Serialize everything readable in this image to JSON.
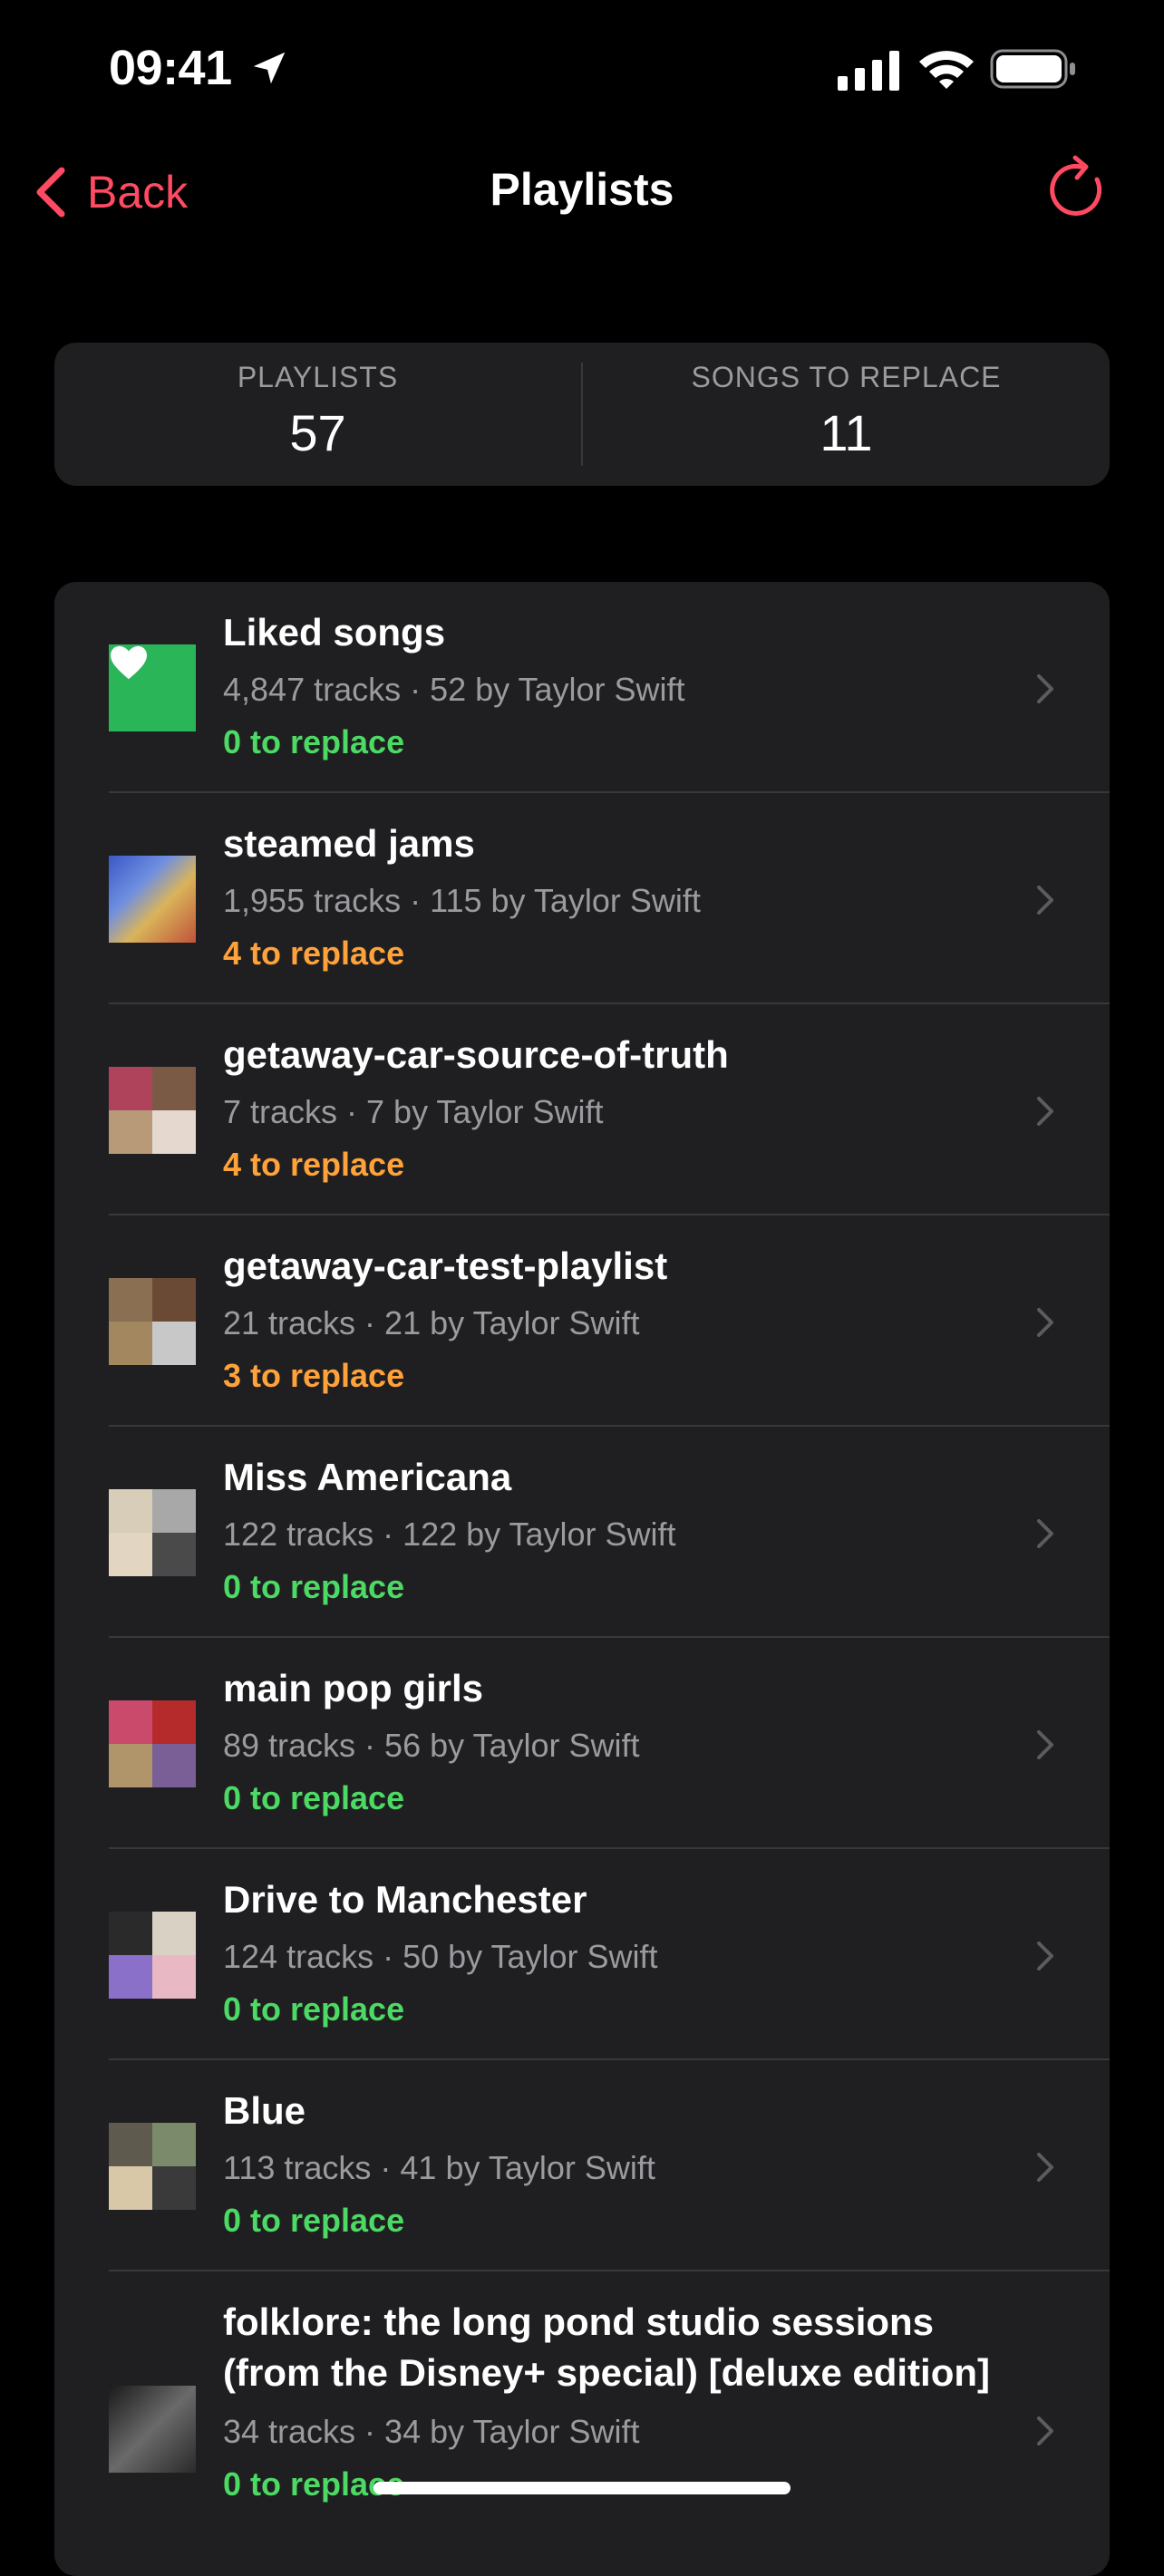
{
  "status_bar": {
    "time": "09:41"
  },
  "nav": {
    "back_label": "Back",
    "title": "Playlists"
  },
  "stats": {
    "playlists_label": "PLAYLISTS",
    "playlists_value": "57",
    "songs_label": "SONGS TO REPLACE",
    "songs_value": "11"
  },
  "colors": {
    "accent": "#ff4a62",
    "ok": "#4cd964",
    "warn": "#ffa23a"
  },
  "playlists": [
    {
      "title": "Liked songs",
      "meta": "4,847 tracks · 52 by Taylor Swift",
      "replace": "0 to replace",
      "status": "ok",
      "artwork": "heart-icon"
    },
    {
      "title": "steamed jams",
      "meta": "1,955 tracks · 115 by Taylor Swift",
      "replace": "4 to replace",
      "status": "warn",
      "artwork": "cartoon-cover"
    },
    {
      "title": "getaway-car-source-of-truth",
      "meta": "7 tracks · 7 by Taylor Swift",
      "replace": "4 to replace",
      "status": "warn",
      "artwork": "album-mosaic"
    },
    {
      "title": "getaway-car-test-playlist",
      "meta": "21 tracks · 21 by Taylor Swift",
      "replace": "3 to replace",
      "status": "warn",
      "artwork": "album-mosaic"
    },
    {
      "title": "Miss Americana",
      "meta": "122 tracks · 122 by Taylor Swift",
      "replace": "0 to replace",
      "status": "ok",
      "artwork": "album-mosaic"
    },
    {
      "title": "main pop girls",
      "meta": "89 tracks · 56 by Taylor Swift",
      "replace": "0 to replace",
      "status": "ok",
      "artwork": "album-mosaic"
    },
    {
      "title": "Drive to Manchester",
      "meta": "124 tracks · 50 by Taylor Swift",
      "replace": "0 to replace",
      "status": "ok",
      "artwork": "album-mosaic"
    },
    {
      "title": "Blue",
      "meta": "113 tracks · 41 by Taylor Swift",
      "replace": "0 to replace",
      "status": "ok",
      "artwork": "album-mosaic"
    },
    {
      "title": "folklore: the long pond studio sessions",
      "title_line2": "(from the Disney+ special) [deluxe edition]",
      "meta": "34 tracks · 34 by Taylor Swift",
      "replace": "0 to replace",
      "status": "ok",
      "artwork": "photo-cover"
    }
  ]
}
